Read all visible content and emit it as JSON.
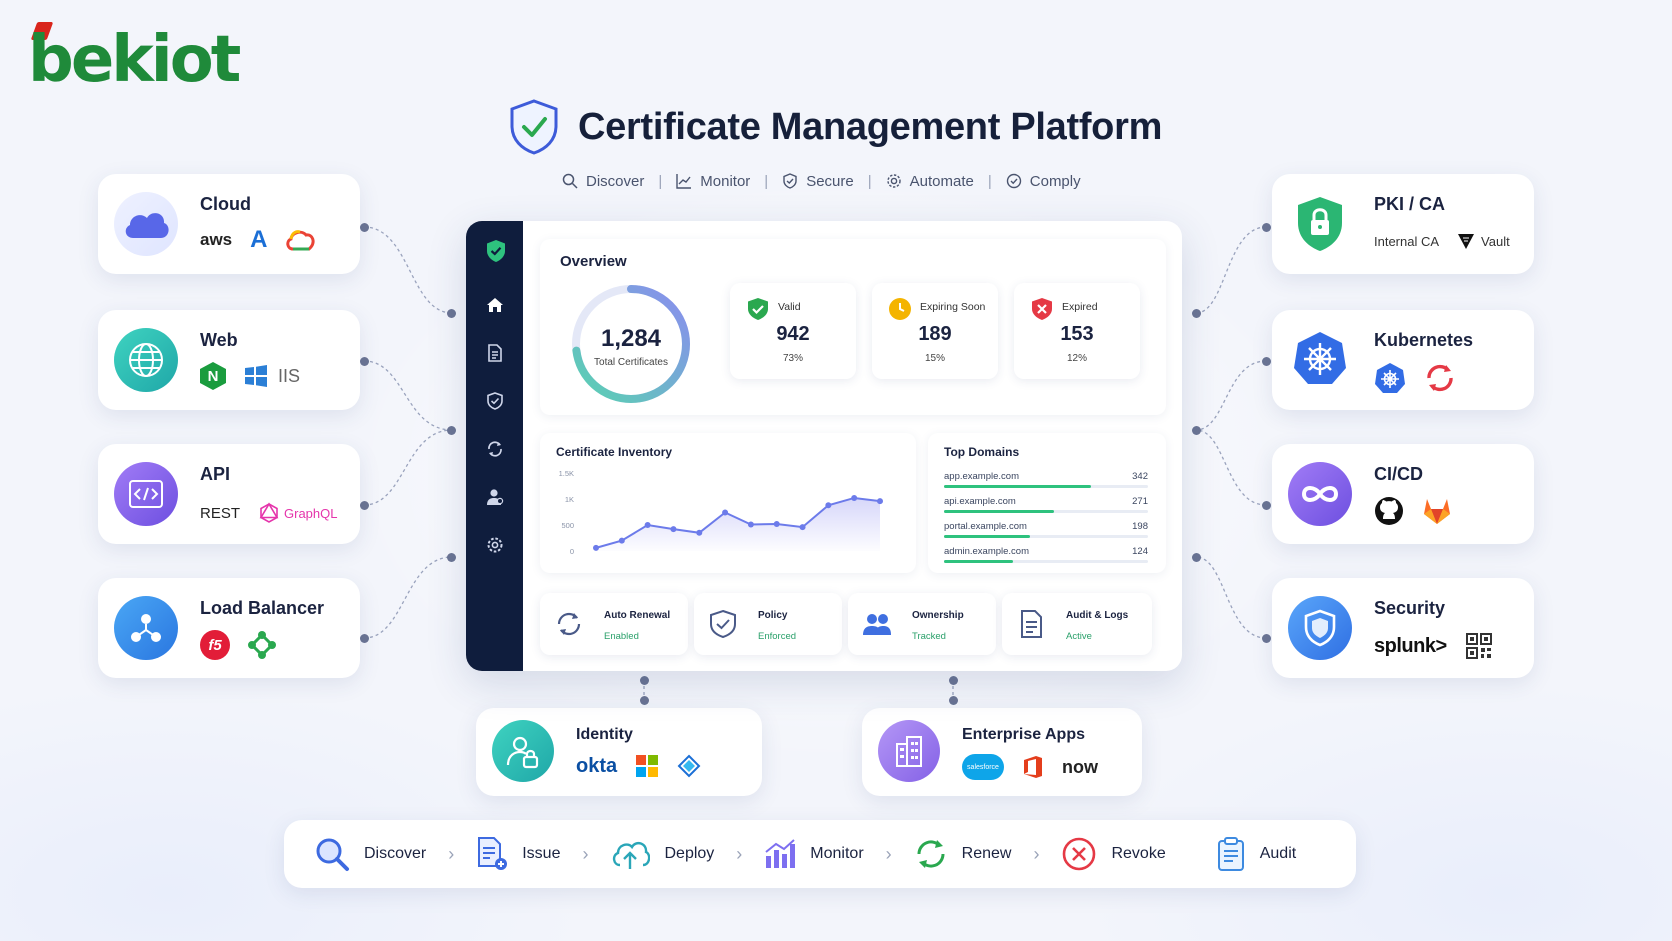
{
  "brand": {
    "name": "bekiot"
  },
  "header": {
    "title": "Certificate Management Platform",
    "subnav": [
      {
        "label": "Discover",
        "icon": "search-icon"
      },
      {
        "label": "Monitor",
        "icon": "chart-icon"
      },
      {
        "label": "Secure",
        "icon": "shield-icon"
      },
      {
        "label": "Automate",
        "icon": "gear-icon"
      },
      {
        "label": "Comply",
        "icon": "check-circle-icon"
      }
    ]
  },
  "categories": {
    "cloud": {
      "title": "Cloud",
      "logos": [
        "aws",
        "A"
      ]
    },
    "web": {
      "title": "Web",
      "logos": [
        "N",
        "IIS"
      ]
    },
    "api": {
      "title": "API",
      "logos": [
        "REST",
        "GraphQL"
      ]
    },
    "load_balancer": {
      "title": "Load Balancer",
      "logos": [
        "f5"
      ]
    },
    "pki": {
      "title": "PKI / CA",
      "logos": [
        "Internal CA",
        "Vault"
      ]
    },
    "kubernetes": {
      "title": "Kubernetes"
    },
    "cicd": {
      "title": "CI/CD"
    },
    "security": {
      "title": "Security",
      "logos": [
        "splunk>"
      ]
    },
    "identity": {
      "title": "Identity",
      "logos": [
        "okta"
      ]
    },
    "enterprise_apps": {
      "title": "Enterprise Apps",
      "logos": [
        "salesforce",
        "now"
      ]
    }
  },
  "dashboard": {
    "overview": {
      "title": "Overview",
      "total_value": "1,284",
      "total_label": "Total Certificates",
      "total_ring_fraction": 0.73
    },
    "stats": [
      {
        "label": "Valid",
        "value": "942",
        "pct": "73%",
        "color": "#2aa84f"
      },
      {
        "label": "Expiring Soon",
        "value": "189",
        "pct": "15%",
        "color": "#f4b400"
      },
      {
        "label": "Expired",
        "value": "153",
        "pct": "12%",
        "color": "#e53945"
      }
    ],
    "inventory": {
      "title": "Certificate Inventory"
    },
    "top_domains": {
      "title": "Top Domains",
      "rows": [
        {
          "name": "app.example.com",
          "count": "342",
          "fraction": 0.72
        },
        {
          "name": "api.example.com",
          "count": "271",
          "fraction": 0.54
        },
        {
          "name": "portal.example.com",
          "count": "198",
          "fraction": 0.42
        },
        {
          "name": "admin.example.com",
          "count": "124",
          "fraction": 0.34
        }
      ]
    },
    "features": [
      {
        "name": "Auto Renewal",
        "state": "Enabled",
        "icon": "refresh-icon"
      },
      {
        "name": "Policy",
        "state": "Enforced",
        "icon": "shield-check-icon"
      },
      {
        "name": "Ownership",
        "state": "Tracked",
        "icon": "users-icon"
      },
      {
        "name": "Audit & Logs",
        "state": "Active",
        "icon": "document-icon"
      }
    ]
  },
  "chart_data": {
    "type": "area",
    "title": "Certificate Inventory",
    "xlabel": "",
    "ylabel": "",
    "yticks": [
      "1.5K",
      "1K",
      "500",
      "0"
    ],
    "ylim": [
      0,
      1500
    ],
    "x": [
      1,
      2,
      3,
      4,
      5,
      6,
      7,
      8,
      9,
      10,
      11,
      12
    ],
    "values": [
      60,
      200,
      500,
      420,
      350,
      740,
      510,
      520,
      460,
      880,
      1020,
      960
    ],
    "series_color": "#6c7bea"
  },
  "workflow": [
    {
      "label": "Discover",
      "icon": "magnifier-icon"
    },
    {
      "label": "Issue",
      "icon": "issue-document-icon"
    },
    {
      "label": "Deploy",
      "icon": "cloud-upload-icon"
    },
    {
      "label": "Monitor",
      "icon": "bar-chart-icon"
    },
    {
      "label": "Renew",
      "icon": "renew-icon"
    },
    {
      "label": "Revoke",
      "icon": "revoke-icon"
    },
    {
      "label": "Audit",
      "icon": "clipboard-icon"
    }
  ],
  "colors": {
    "navy": "#0f1d3d",
    "green": "#2aa84f",
    "accent": "#6c7bea"
  }
}
